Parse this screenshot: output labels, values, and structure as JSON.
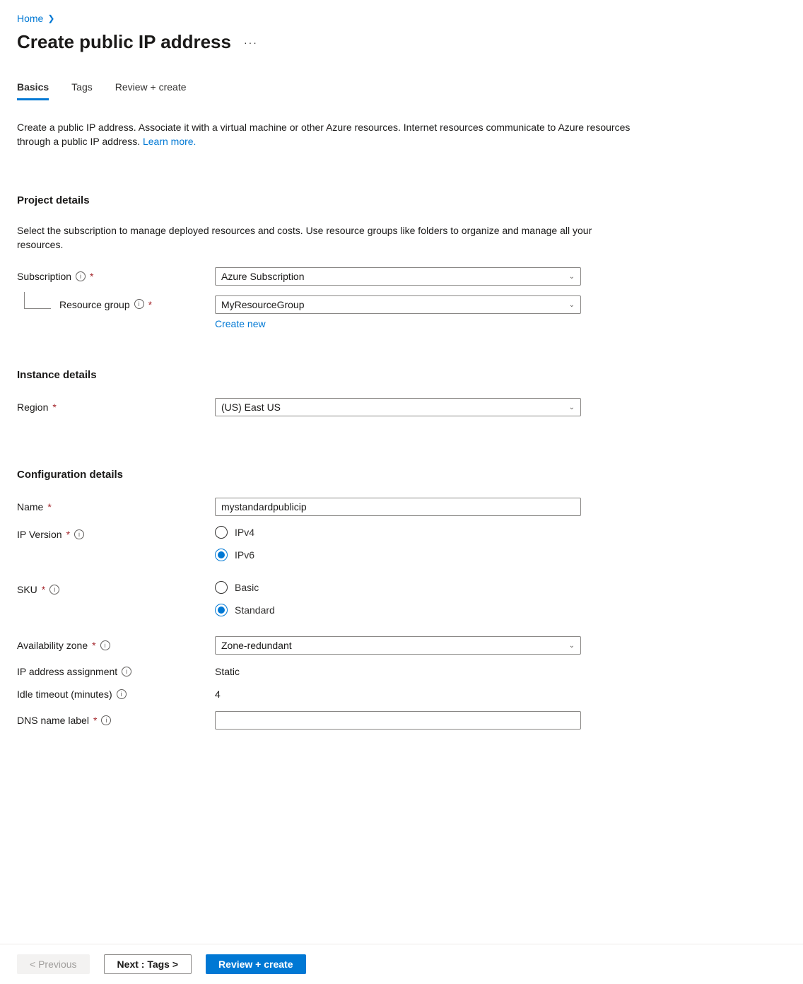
{
  "breadcrumb": {
    "home": "Home"
  },
  "title": "Create public IP address",
  "tabs": {
    "basics": "Basics",
    "tags": "Tags",
    "review": "Review + create"
  },
  "intro": {
    "text": "Create a public IP address. Associate it with a virtual machine or other Azure resources. Internet resources communicate to Azure resources through a public IP address. ",
    "learn_more": "Learn more."
  },
  "project": {
    "heading": "Project details",
    "desc": "Select the subscription to manage deployed resources and costs. Use resource groups like folders to organize and manage all your resources.",
    "subscription_label": "Subscription",
    "subscription_value": "Azure Subscription",
    "rg_label": "Resource group",
    "rg_value": "MyResourceGroup",
    "create_new": "Create new"
  },
  "instance": {
    "heading": "Instance details",
    "region_label": "Region",
    "region_value": "(US) East US"
  },
  "config": {
    "heading": "Configuration details",
    "name_label": "Name",
    "name_value": "mystandardpublicip",
    "ipver_label": "IP Version",
    "ipver_ipv4": "IPv4",
    "ipver_ipv6": "IPv6",
    "sku_label": "SKU",
    "sku_basic": "Basic",
    "sku_standard": "Standard",
    "az_label": "Availability zone",
    "az_value": "Zone-redundant",
    "assign_label": "IP address assignment",
    "assign_value": "Static",
    "idle_label": "Idle timeout (minutes)",
    "idle_value": "4",
    "dns_label": "DNS name label",
    "dns_value": ""
  },
  "footer": {
    "previous": "< Previous",
    "next": "Next : Tags >",
    "review": "Review + create"
  }
}
